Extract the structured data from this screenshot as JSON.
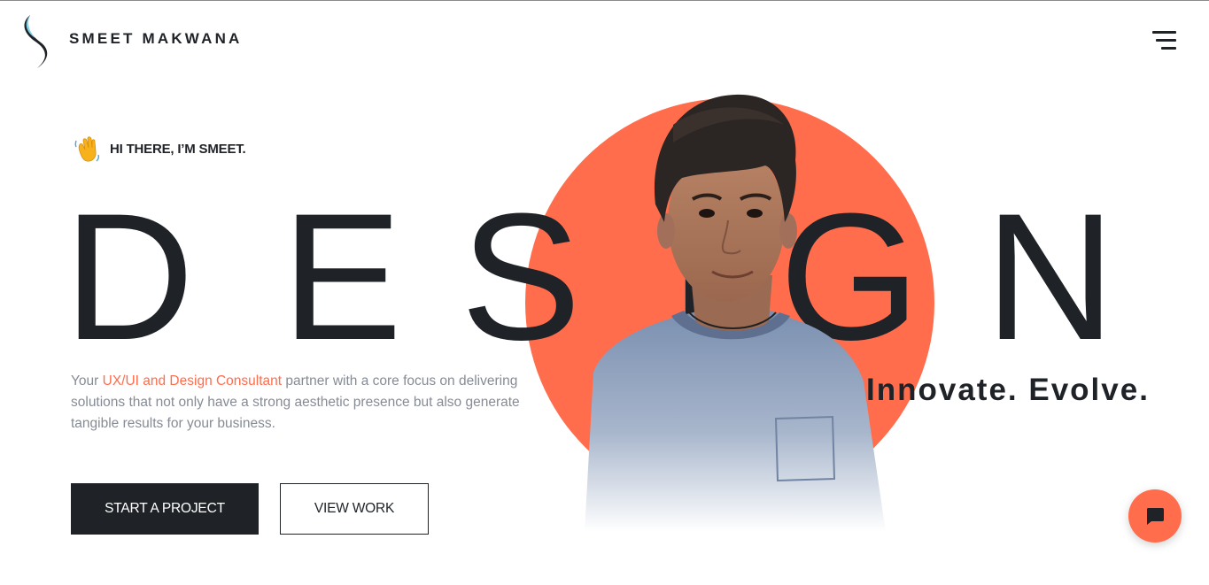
{
  "header": {
    "brand_name": "SMEET MAKWANA",
    "logo_icon": "swoosh-logo",
    "menu_icon": "hamburger-menu-icon"
  },
  "hero": {
    "greeting_icon": "waving-hand-emoji",
    "greeting": "HI THERE, I’M SMEET.",
    "big_word": [
      "D",
      "E",
      "S",
      "I",
      "G",
      "N"
    ],
    "tagline": "Innovate. Evolve.",
    "intro": {
      "before": "Your ",
      "highlight": "UX/UI and Design Consultant",
      "after": " partner with a core focus on delivering solutions that not only have a strong aesthetic presence but also generate tangible results for your business."
    },
    "primary_button": "START A PROJECT",
    "secondary_button": "VIEW WORK"
  },
  "chat": {
    "icon": "chat-bubble-icon"
  },
  "colors": {
    "accent": "#ff6d4d",
    "dark": "#1f2328",
    "muted_text": "#868b94",
    "background": "#ffffff"
  }
}
